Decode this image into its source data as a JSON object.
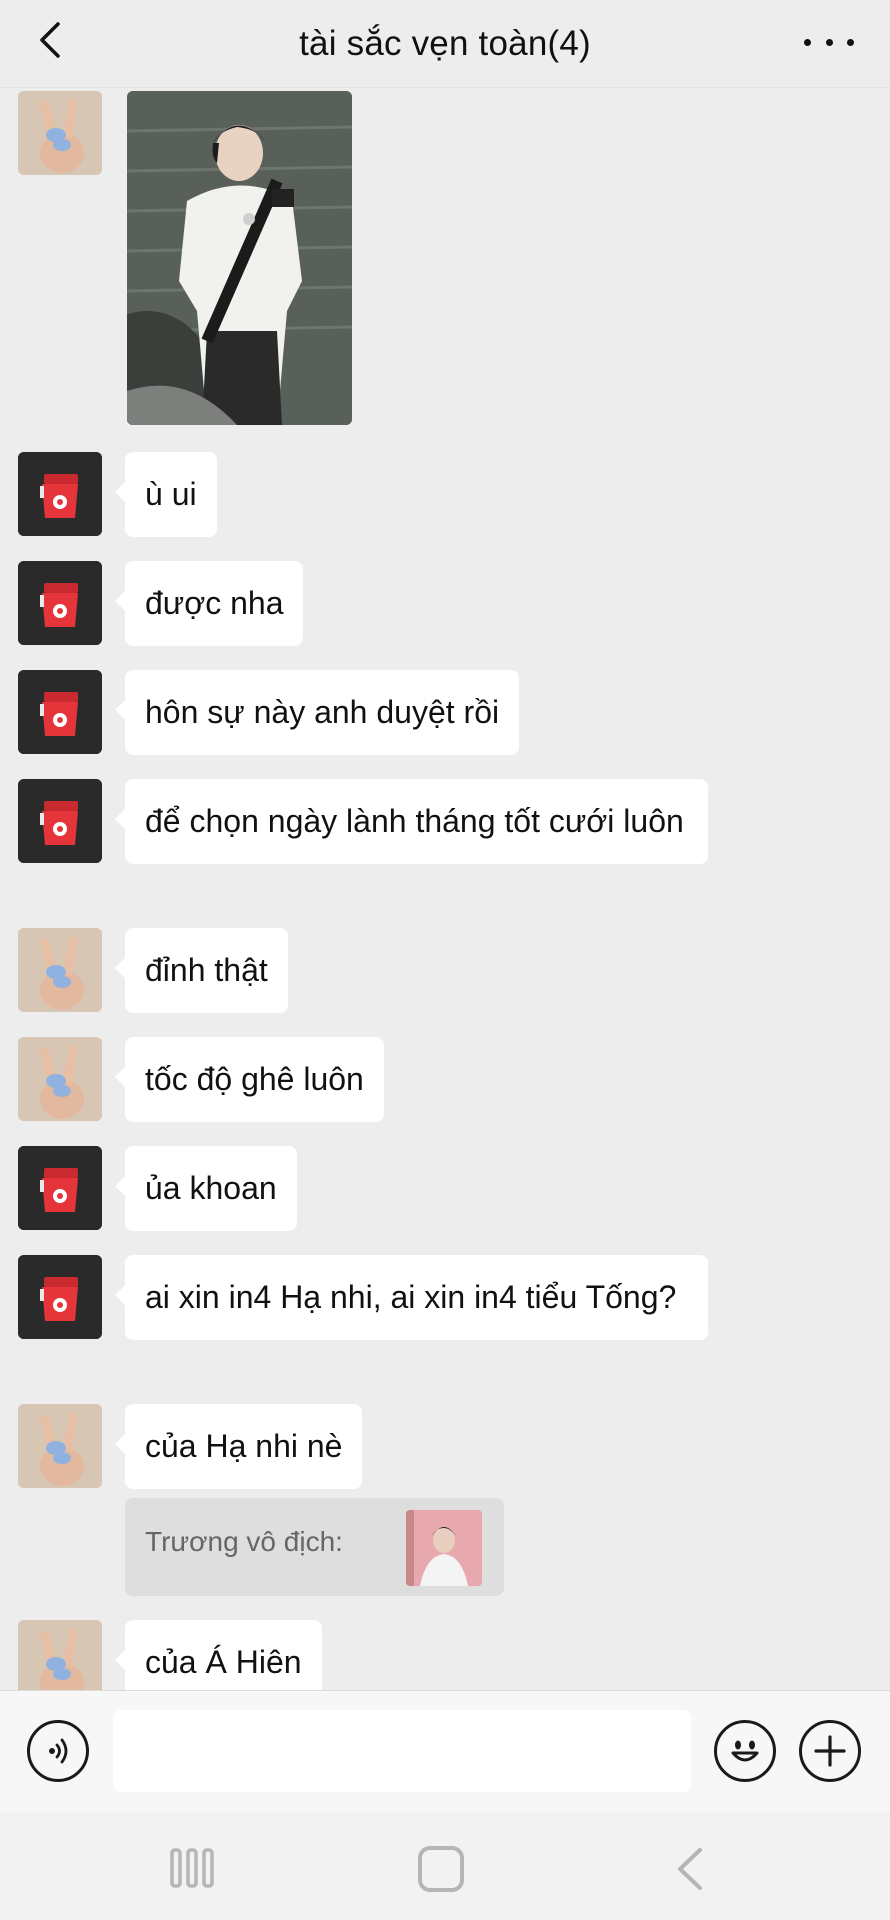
{
  "header": {
    "title": "tài sắc vẹn toàn(4)"
  },
  "messages": [
    {
      "type": "image",
      "avatar": "hand-peace-avatar",
      "image": "boy-white-shirt-photo"
    },
    {
      "type": "text",
      "avatar": "red-cup-avatar",
      "text": "ù ui"
    },
    {
      "type": "text",
      "avatar": "red-cup-avatar",
      "text": "được nha"
    },
    {
      "type": "text",
      "avatar": "red-cup-avatar",
      "text": "hôn sự này anh duyệt rồi"
    },
    {
      "type": "text",
      "avatar": "red-cup-avatar",
      "text": "để chọn ngày lành tháng tốt cưới luôn"
    },
    {
      "type": "text",
      "avatar": "hand-peace-avatar",
      "text": "đỉnh thật"
    },
    {
      "type": "text",
      "avatar": "hand-peace-avatar",
      "text": "tốc độ ghê luôn"
    },
    {
      "type": "text",
      "avatar": "red-cup-avatar",
      "text": "ủa khoan"
    },
    {
      "type": "text",
      "avatar": "red-cup-avatar",
      "text": "ai xin in4 Hạ nhi, ai xin in4 tiểu Tống?"
    },
    {
      "type": "text",
      "avatar": "hand-peace-avatar",
      "text": "của Hạ nhi nè"
    },
    {
      "type": "text",
      "avatar": "hand-peace-avatar",
      "text": "của Á Hiên"
    }
  ],
  "quote": {
    "text": "Trương vô địch:",
    "thumbnail": "boy-pink-background-thumbnail"
  },
  "input_bar": {
    "value": "",
    "placeholder": ""
  },
  "icons": {
    "back": "chevron-left-icon",
    "more": "more-dots-icon",
    "voice": "voice-icon",
    "emoji": "emoji-icon",
    "plus": "plus-icon"
  },
  "colors": {
    "background": "#ededed",
    "bubble": "#ffffff",
    "quote_bg": "#dedede",
    "cup_red": "#e5343a"
  }
}
